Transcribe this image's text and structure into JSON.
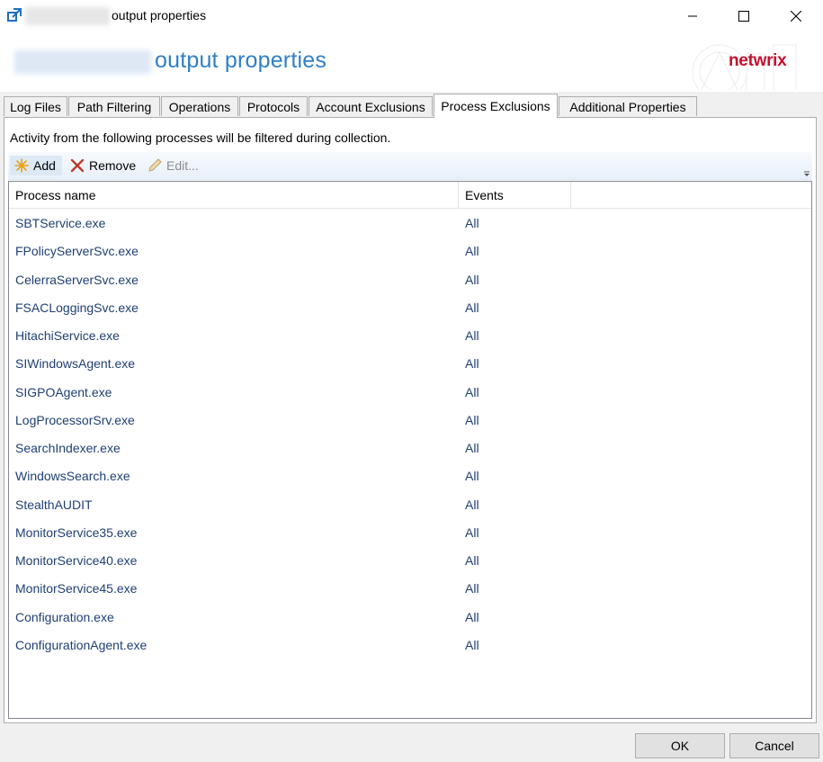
{
  "window": {
    "title": "output properties",
    "minimize_label": "",
    "maximize_label": "",
    "close_label": ""
  },
  "banner": {
    "title": "output properties",
    "logo": "netwrix"
  },
  "tabs": [
    {
      "label": "Log Files",
      "active": false
    },
    {
      "label": "Path Filtering",
      "active": false
    },
    {
      "label": "Operations",
      "active": false
    },
    {
      "label": "Protocols",
      "active": false
    },
    {
      "label": "Account Exclusions",
      "active": false
    },
    {
      "label": "Process Exclusions",
      "active": true
    },
    {
      "label": "Additional Properties",
      "active": false
    }
  ],
  "panel": {
    "description": "Activity from the following processes will be filtered during collection.",
    "toolbar": {
      "add": "Add",
      "remove": "Remove",
      "edit": "Edit..."
    },
    "columns": [
      "Process name",
      "Events"
    ],
    "rows": [
      {
        "name": "SBTService.exe",
        "events": "All"
      },
      {
        "name": "FPolicyServerSvc.exe",
        "events": "All"
      },
      {
        "name": "CelerraServerSvc.exe",
        "events": "All"
      },
      {
        "name": "FSACLoggingSvc.exe",
        "events": "All"
      },
      {
        "name": "HitachiService.exe",
        "events": "All"
      },
      {
        "name": "SIWindowsAgent.exe",
        "events": "All"
      },
      {
        "name": "SIGPOAgent.exe",
        "events": "All"
      },
      {
        "name": "LogProcessorSrv.exe",
        "events": "All"
      },
      {
        "name": "SearchIndexer.exe",
        "events": "All"
      },
      {
        "name": "WindowsSearch.exe",
        "events": "All"
      },
      {
        "name": "StealthAUDIT",
        "events": "All"
      },
      {
        "name": "MonitorService35.exe",
        "events": "All"
      },
      {
        "name": "MonitorService40.exe",
        "events": "All"
      },
      {
        "name": "MonitorService45.exe",
        "events": "All"
      },
      {
        "name": "Configuration.exe",
        "events": "All"
      },
      {
        "name": "ConfigurationAgent.exe",
        "events": "All"
      }
    ]
  },
  "buttons": {
    "ok": "OK",
    "cancel": "Cancel"
  },
  "colors": {
    "accent": "#2f7fc6",
    "brand": "#c8102e",
    "list_text": "#1f3f73"
  }
}
